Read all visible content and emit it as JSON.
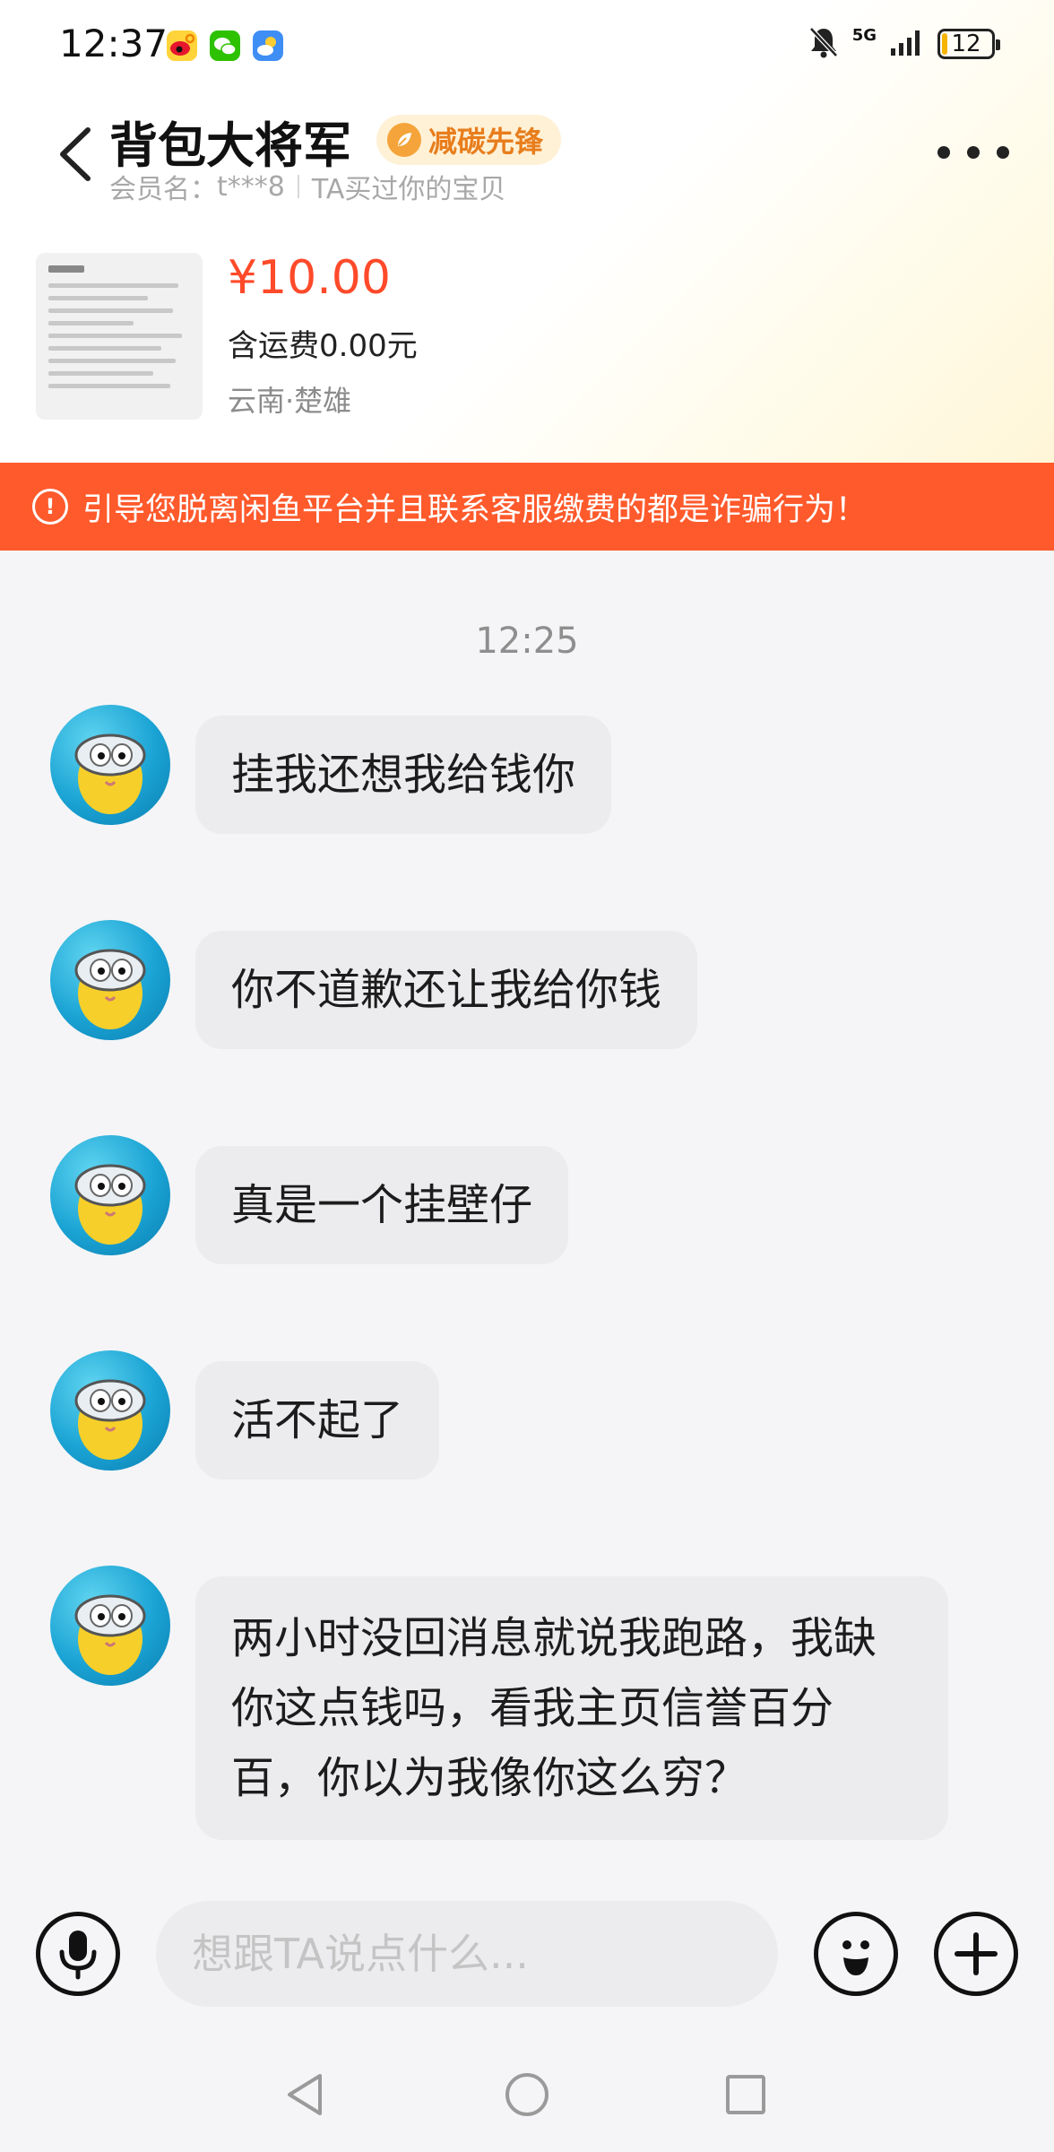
{
  "status_bar": {
    "time": "12:37",
    "apps": [
      "weibo-icon",
      "wechat-icon",
      "weather-icon"
    ],
    "network": "5G",
    "battery": "12",
    "battery_level": 0.12
  },
  "header": {
    "seller_name": "背包大将军",
    "badge_label": "减碳先锋",
    "member_label": "会员名：",
    "member_id": "t***8",
    "relation": "TA买过你的宝贝"
  },
  "product": {
    "price": "¥10.00",
    "shipping": "含运费0.00元",
    "location": "云南·楚雄"
  },
  "warning": {
    "text": "引导您脱离闲鱼平台并且联系客服缴费的都是诈骗行为！"
  },
  "chat": {
    "time": "12:25",
    "messages": [
      {
        "text": "挂我还想我给钱你"
      },
      {
        "text": "你不道歉还让我给你钱"
      },
      {
        "text": "真是一个挂壁仔"
      },
      {
        "text": "活不起了"
      },
      {
        "text": "两小时没回消息就说我跑路，我缺你这点钱吗，看我主页信誉百分百，你以为我像你这么穷？"
      }
    ]
  },
  "input": {
    "placeholder": "想跟TA说点什么..."
  },
  "colors": {
    "accent": "#ff4a2a",
    "warning_bg": "#ff5a2c",
    "badge_text": "#e87d1c",
    "bubble_bg": "#ececef"
  }
}
